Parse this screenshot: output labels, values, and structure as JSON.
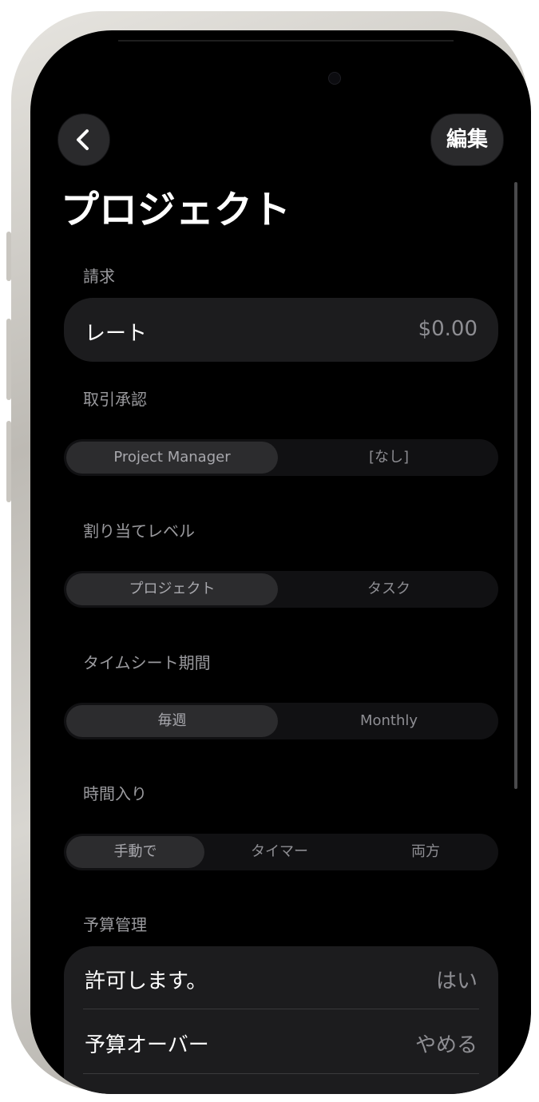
{
  "nav": {
    "edit_label": "編集"
  },
  "page": {
    "title": "プロジェクト"
  },
  "sections": {
    "billing": {
      "label": "請求",
      "rate_label": "レート",
      "rate_value": "$0.00"
    },
    "approval": {
      "label": "取引承認",
      "options": [
        "Project Manager",
        "[なし]"
      ],
      "selected": "Project Manager"
    },
    "assignment_level": {
      "label": "割り当てレベル",
      "options": [
        "プロジェクト",
        "タスク"
      ],
      "selected": "プロジェクト"
    },
    "timesheet_period": {
      "label": "タイムシート期間",
      "options": [
        "毎週",
        "Monthly"
      ],
      "selected": "毎週"
    },
    "time_entry": {
      "label": "時間入り",
      "options": [
        "手動で",
        "タイマー",
        "両方"
      ],
      "selected": "手動で"
    },
    "budget": {
      "label": "予算管理",
      "rows": [
        {
          "label": "許可します。",
          "value": "はい"
        },
        {
          "label": "予算オーバー",
          "value": "やめる"
        }
      ]
    }
  },
  "icons": {
    "back": "chevron-left-icon"
  }
}
